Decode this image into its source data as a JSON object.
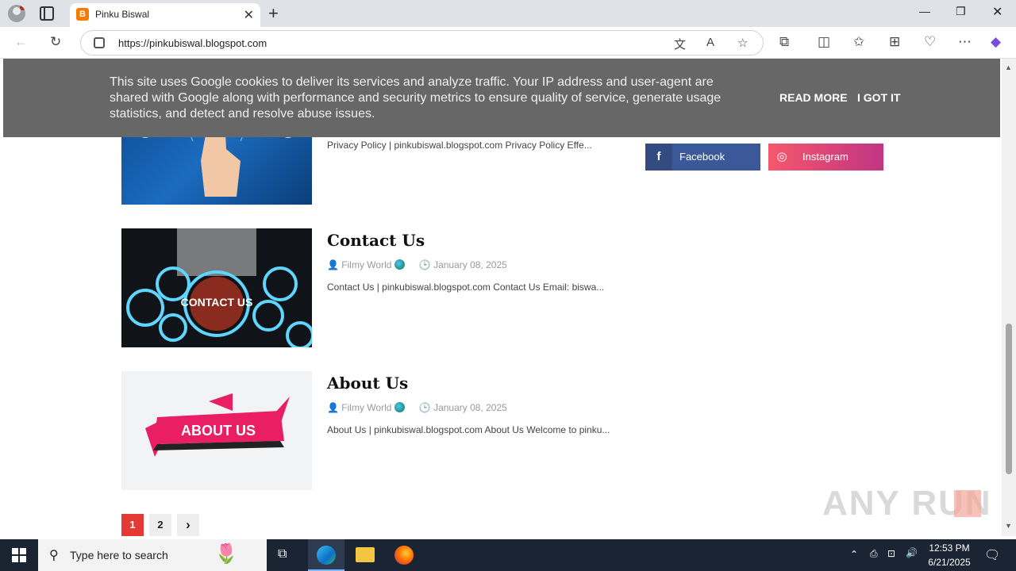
{
  "browser": {
    "tab_title": "Pinku Biswal",
    "favicon_letter": "B",
    "url": "https://pinkubiswal.blogspot.com"
  },
  "cookie_banner": {
    "message": "This site uses Google cookies to deliver its services and analyze traffic. Your IP address and user-agent are shared with Google along with performance and security metrics to ensure quality of service, generate usage statistics, and detect and resolve abuse issues.",
    "read_more": "READ MORE",
    "got_it": "I GOT IT"
  },
  "posts": [
    {
      "title": "",
      "snippet": "Privacy Policy | pinkubiswal.blogspot.com Privacy Policy Effe..."
    },
    {
      "title": "Contact Us",
      "author": "Filmy World",
      "date": "January 08, 2025",
      "snippet": "Contact Us | pinkubiswal.blogspot.com Contact Us Email: biswa...",
      "thumb_text": "CONTACT US"
    },
    {
      "title": "About Us",
      "author": "Filmy World",
      "date": "January 08, 2025",
      "snippet": "About Us | pinkubiswal.blogspot.com About Us Welcome to pinku...",
      "thumb_text": "ABOUT US"
    }
  ],
  "social": {
    "facebook": "Facebook",
    "instagram": "Instagram"
  },
  "pagination": {
    "current": "1",
    "next_page": "2",
    "next_icon": "›"
  },
  "taskbar": {
    "search_placeholder": "Type here to search",
    "time": "12:53 PM",
    "date": "6/21/2025"
  },
  "watermark": "ANY RUN",
  "colors": {
    "facebook": "#3b5998",
    "instagram_start": "#f5576c",
    "instagram_end": "#c13584",
    "pager_active": "#e53935",
    "cookie_bg": "#676767"
  }
}
